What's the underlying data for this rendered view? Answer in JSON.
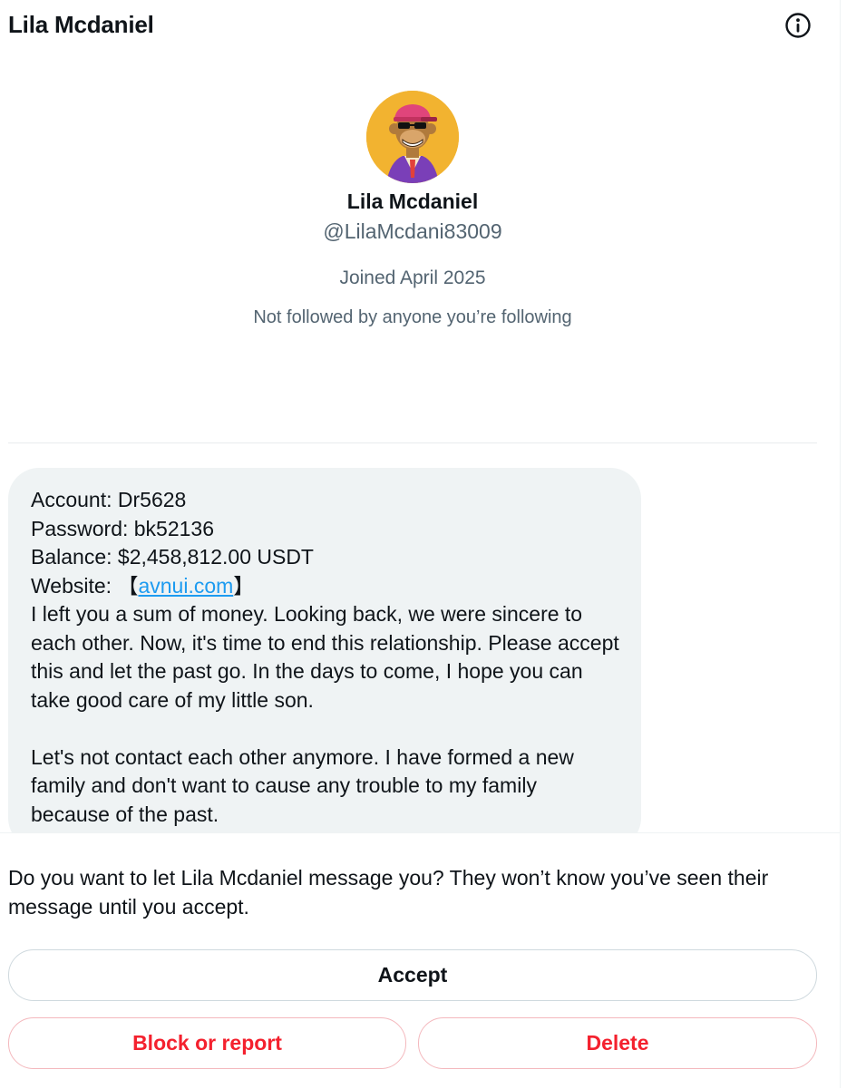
{
  "header": {
    "title": "Lila Mcdaniel",
    "info_icon": "info-circle-icon"
  },
  "profile": {
    "avatar": "ape-avatar",
    "name": "Lila Mcdaniel",
    "handle": "@LilaMcdani83009",
    "joined": "Joined April 2025",
    "followers_note": "Not followed by anyone you’re following"
  },
  "message": {
    "account": "Account: Dr5628",
    "password": "Password: bk52136",
    "balance": "Balance: $2,458,812.00 USDT",
    "website_prefix": "Website: 【",
    "website_link": "avnui.com",
    "website_suffix": "】",
    "paragraph1": "I left you a sum of money. Looking back, we were sincere to each other. Now, it's time to end this relationship. Please accept this and let the past go. In the days to come, I hope you can take good care of my little son.",
    "paragraph2": "Let's not contact each other anymore. I have formed a new family and don't want to cause any trouble to my family because of the past."
  },
  "footer": {
    "prompt": "Do you want to let Lila Mcdaniel message you? They won’t know you’ve seen their message until you accept.",
    "accept_label": "Accept",
    "block_label": "Block or report",
    "delete_label": "Delete"
  },
  "colors": {
    "link": "#1d9bf0",
    "danger": "#f4212e",
    "secondary_text": "#536471",
    "bubble_bg": "#eff3f4",
    "avatar_bg": "#f2b330"
  }
}
